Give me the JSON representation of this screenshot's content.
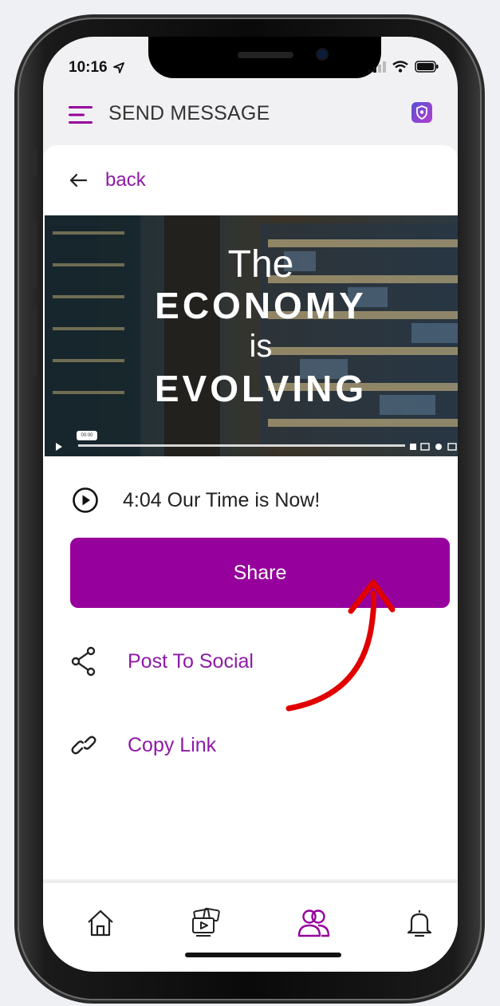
{
  "status_bar": {
    "time": "10:16"
  },
  "header": {
    "title": "SEND MESSAGE",
    "menu_icon": "hamburger-menu-icon",
    "badge_icon": "app-shield-icon"
  },
  "back": {
    "label": "back",
    "icon": "arrow-left-icon"
  },
  "video": {
    "line1": "The",
    "line2": "ECONOMY",
    "line3": "is",
    "line4": "EVOLVING",
    "timestamp": "00:00"
  },
  "message": {
    "label": "4:04 Our Time is Now!",
    "icon": "play-circle-icon"
  },
  "share": {
    "label": "Share"
  },
  "options": [
    {
      "label": "Post To Social",
      "icon": "share-nodes-icon"
    },
    {
      "label": "Copy Link",
      "icon": "link-icon"
    }
  ],
  "bottom_nav": [
    {
      "name": "home",
      "icon": "home-icon"
    },
    {
      "name": "media",
      "icon": "media-library-icon"
    },
    {
      "name": "contacts",
      "icon": "contacts-icon",
      "active": true
    },
    {
      "name": "notifications",
      "icon": "bell-icon"
    }
  ],
  "colors": {
    "accent": "#96009c",
    "link": "#8d1aa6",
    "annotation_arrow": "#e00000"
  }
}
